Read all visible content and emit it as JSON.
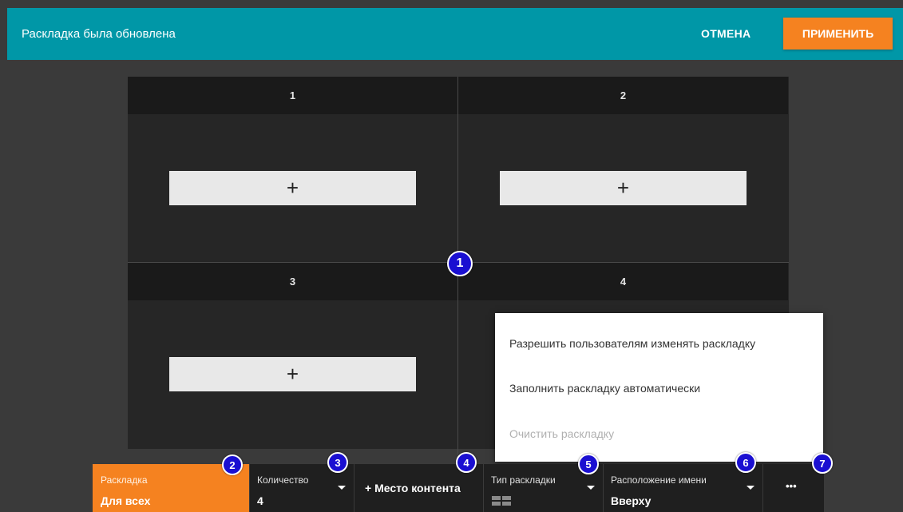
{
  "header": {
    "title": "Раскладка была обновлена",
    "cancel_label": "ОТМЕНА",
    "apply_label": "ПРИМЕНИТЬ"
  },
  "grid": {
    "cells": [
      {
        "label": "1",
        "add": "+"
      },
      {
        "label": "2",
        "add": "+"
      },
      {
        "label": "3",
        "add": "+"
      },
      {
        "label": "4",
        "add": "+"
      }
    ]
  },
  "menu": {
    "items": [
      {
        "label": "Разрешить пользователям изменять раскладку",
        "disabled": false
      },
      {
        "label": "Заполнить раскладку автоматически",
        "disabled": false
      },
      {
        "label": "Очистить раскладку",
        "disabled": true
      }
    ]
  },
  "toolbar": {
    "layout": {
      "label": "Раскладка",
      "value": "Для всех"
    },
    "count": {
      "label": "Количество",
      "value": "4"
    },
    "add_content": {
      "label": "+ Место контента"
    },
    "layout_type": {
      "label": "Тип раскладки"
    },
    "name_position": {
      "label": "Расположение имени",
      "value": "Вверху"
    },
    "more": {
      "label": "•••"
    }
  },
  "badges": [
    "1",
    "2",
    "3",
    "4",
    "5",
    "6",
    "7"
  ],
  "icons": {
    "dropdown": "chevron-down-icon",
    "layout_type": "grid-layout-icon",
    "more": "more-horizontal-icon"
  },
  "colors": {
    "header_bg": "#0097a7",
    "accent_orange": "#f58220",
    "badge_blue": "#1a0fd1"
  }
}
